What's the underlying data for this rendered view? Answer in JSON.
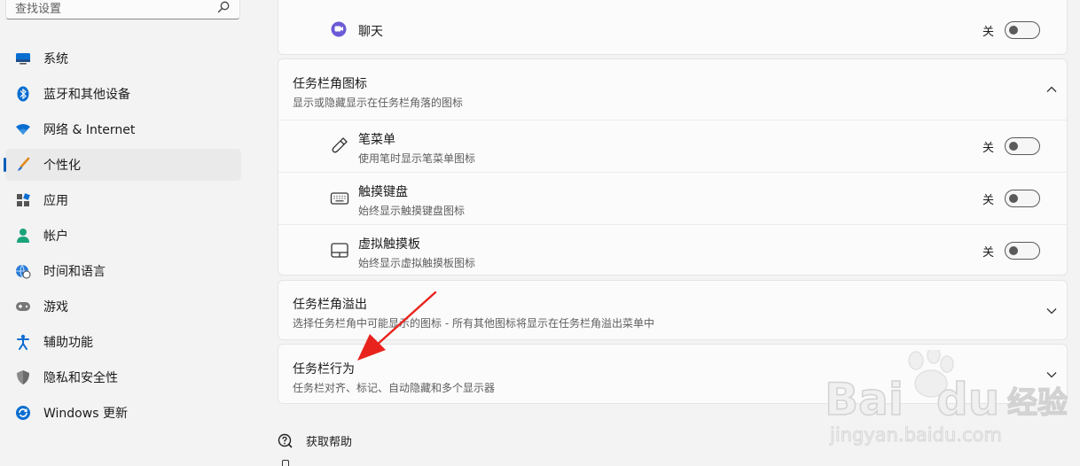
{
  "search": {
    "placeholder": "查找设置"
  },
  "sidebar": {
    "items": [
      {
        "label": "系统",
        "icon": "monitor-icon"
      },
      {
        "label": "蓝牙和其他设备",
        "icon": "bluetooth-icon"
      },
      {
        "label": "网络 & Internet",
        "icon": "wifi-icon"
      },
      {
        "label": "个性化",
        "icon": "brush-icon",
        "active": true
      },
      {
        "label": "应用",
        "icon": "apps-icon"
      },
      {
        "label": "帐户",
        "icon": "person-icon"
      },
      {
        "label": "时间和语言",
        "icon": "globe-clock-icon"
      },
      {
        "label": "游戏",
        "icon": "gamepad-icon"
      },
      {
        "label": "辅助功能",
        "icon": "accessibility-icon"
      },
      {
        "label": "隐私和安全性",
        "icon": "shield-icon"
      },
      {
        "label": "Windows 更新",
        "icon": "update-icon"
      }
    ]
  },
  "main": {
    "chat": {
      "label": "聊天",
      "state": "关",
      "icon": "chat-icon"
    },
    "corner_icons": {
      "title": "任务栏角图标",
      "subtitle": "显示或隐藏显示在任务栏角落的图标",
      "items": [
        {
          "title": "笔菜单",
          "subtitle": "使用笔时显示笔菜单图标",
          "state": "关",
          "icon": "pen-icon"
        },
        {
          "title": "触摸键盘",
          "subtitle": "始终显示触摸键盘图标",
          "state": "关",
          "icon": "keyboard-icon"
        },
        {
          "title": "虚拟触摸板",
          "subtitle": "始终显示虚拟触摸板图标",
          "state": "关",
          "icon": "touchpad-icon"
        }
      ]
    },
    "corner_overflow": {
      "title": "任务栏角溢出",
      "subtitle": "选择任务栏角中可能显示的图标 - 所有其他图标将显示在任务栏角溢出菜单中"
    },
    "behaviors": {
      "title": "任务栏行为",
      "subtitle": "任务栏对齐、标记、自动隐藏和多个显示器"
    }
  },
  "help": {
    "label": "获取帮助"
  },
  "watermark": {
    "brand": "Baidu",
    "product": "经验",
    "url": "jingyan.baidu.com"
  },
  "colors": {
    "accent": "#005fb8",
    "arrow": "#e8231d"
  }
}
